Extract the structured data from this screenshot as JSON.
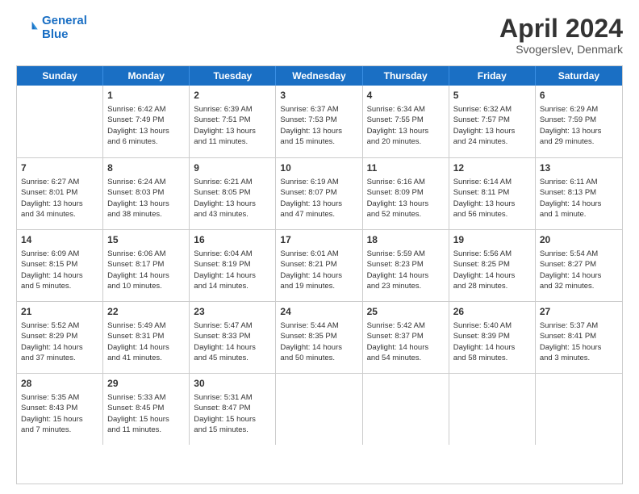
{
  "header": {
    "logo_line1": "General",
    "logo_line2": "Blue",
    "month": "April 2024",
    "location": "Svogerslev, Denmark"
  },
  "days_of_week": [
    "Sunday",
    "Monday",
    "Tuesday",
    "Wednesday",
    "Thursday",
    "Friday",
    "Saturday"
  ],
  "weeks": [
    [
      {
        "day": "",
        "info": ""
      },
      {
        "day": "1",
        "info": "Sunrise: 6:42 AM\nSunset: 7:49 PM\nDaylight: 13 hours\nand 6 minutes."
      },
      {
        "day": "2",
        "info": "Sunrise: 6:39 AM\nSunset: 7:51 PM\nDaylight: 13 hours\nand 11 minutes."
      },
      {
        "day": "3",
        "info": "Sunrise: 6:37 AM\nSunset: 7:53 PM\nDaylight: 13 hours\nand 15 minutes."
      },
      {
        "day": "4",
        "info": "Sunrise: 6:34 AM\nSunset: 7:55 PM\nDaylight: 13 hours\nand 20 minutes."
      },
      {
        "day": "5",
        "info": "Sunrise: 6:32 AM\nSunset: 7:57 PM\nDaylight: 13 hours\nand 24 minutes."
      },
      {
        "day": "6",
        "info": "Sunrise: 6:29 AM\nSunset: 7:59 PM\nDaylight: 13 hours\nand 29 minutes."
      }
    ],
    [
      {
        "day": "7",
        "info": "Sunrise: 6:27 AM\nSunset: 8:01 PM\nDaylight: 13 hours\nand 34 minutes."
      },
      {
        "day": "8",
        "info": "Sunrise: 6:24 AM\nSunset: 8:03 PM\nDaylight: 13 hours\nand 38 minutes."
      },
      {
        "day": "9",
        "info": "Sunrise: 6:21 AM\nSunset: 8:05 PM\nDaylight: 13 hours\nand 43 minutes."
      },
      {
        "day": "10",
        "info": "Sunrise: 6:19 AM\nSunset: 8:07 PM\nDaylight: 13 hours\nand 47 minutes."
      },
      {
        "day": "11",
        "info": "Sunrise: 6:16 AM\nSunset: 8:09 PM\nDaylight: 13 hours\nand 52 minutes."
      },
      {
        "day": "12",
        "info": "Sunrise: 6:14 AM\nSunset: 8:11 PM\nDaylight: 13 hours\nand 56 minutes."
      },
      {
        "day": "13",
        "info": "Sunrise: 6:11 AM\nSunset: 8:13 PM\nDaylight: 14 hours\nand 1 minute."
      }
    ],
    [
      {
        "day": "14",
        "info": "Sunrise: 6:09 AM\nSunset: 8:15 PM\nDaylight: 14 hours\nand 5 minutes."
      },
      {
        "day": "15",
        "info": "Sunrise: 6:06 AM\nSunset: 8:17 PM\nDaylight: 14 hours\nand 10 minutes."
      },
      {
        "day": "16",
        "info": "Sunrise: 6:04 AM\nSunset: 8:19 PM\nDaylight: 14 hours\nand 14 minutes."
      },
      {
        "day": "17",
        "info": "Sunrise: 6:01 AM\nSunset: 8:21 PM\nDaylight: 14 hours\nand 19 minutes."
      },
      {
        "day": "18",
        "info": "Sunrise: 5:59 AM\nSunset: 8:23 PM\nDaylight: 14 hours\nand 23 minutes."
      },
      {
        "day": "19",
        "info": "Sunrise: 5:56 AM\nSunset: 8:25 PM\nDaylight: 14 hours\nand 28 minutes."
      },
      {
        "day": "20",
        "info": "Sunrise: 5:54 AM\nSunset: 8:27 PM\nDaylight: 14 hours\nand 32 minutes."
      }
    ],
    [
      {
        "day": "21",
        "info": "Sunrise: 5:52 AM\nSunset: 8:29 PM\nDaylight: 14 hours\nand 37 minutes."
      },
      {
        "day": "22",
        "info": "Sunrise: 5:49 AM\nSunset: 8:31 PM\nDaylight: 14 hours\nand 41 minutes."
      },
      {
        "day": "23",
        "info": "Sunrise: 5:47 AM\nSunset: 8:33 PM\nDaylight: 14 hours\nand 45 minutes."
      },
      {
        "day": "24",
        "info": "Sunrise: 5:44 AM\nSunset: 8:35 PM\nDaylight: 14 hours\nand 50 minutes."
      },
      {
        "day": "25",
        "info": "Sunrise: 5:42 AM\nSunset: 8:37 PM\nDaylight: 14 hours\nand 54 minutes."
      },
      {
        "day": "26",
        "info": "Sunrise: 5:40 AM\nSunset: 8:39 PM\nDaylight: 14 hours\nand 58 minutes."
      },
      {
        "day": "27",
        "info": "Sunrise: 5:37 AM\nSunset: 8:41 PM\nDaylight: 15 hours\nand 3 minutes."
      }
    ],
    [
      {
        "day": "28",
        "info": "Sunrise: 5:35 AM\nSunset: 8:43 PM\nDaylight: 15 hours\nand 7 minutes."
      },
      {
        "day": "29",
        "info": "Sunrise: 5:33 AM\nSunset: 8:45 PM\nDaylight: 15 hours\nand 11 minutes."
      },
      {
        "day": "30",
        "info": "Sunrise: 5:31 AM\nSunset: 8:47 PM\nDaylight: 15 hours\nand 15 minutes."
      },
      {
        "day": "",
        "info": ""
      },
      {
        "day": "",
        "info": ""
      },
      {
        "day": "",
        "info": ""
      },
      {
        "day": "",
        "info": ""
      }
    ]
  ]
}
